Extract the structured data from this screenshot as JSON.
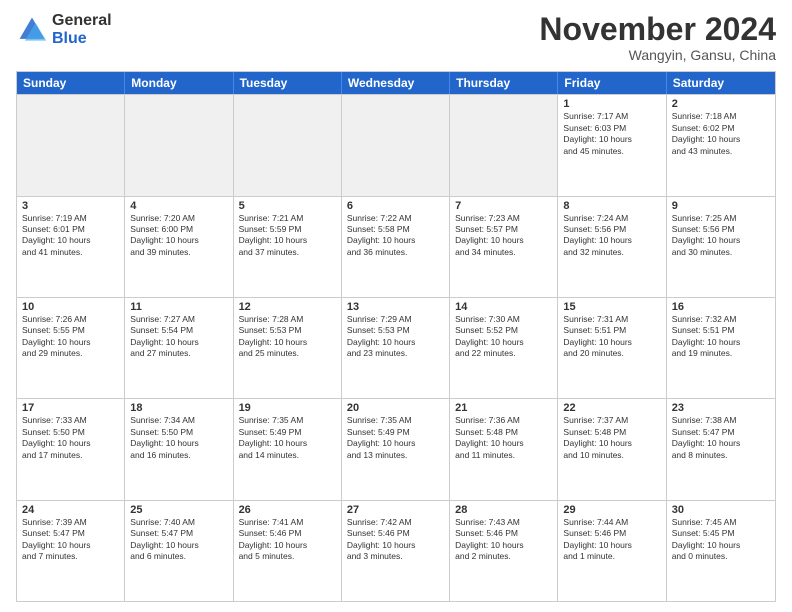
{
  "header": {
    "logo_general": "General",
    "logo_blue": "Blue",
    "month_title": "November 2024",
    "location": "Wangyin, Gansu, China"
  },
  "days_of_week": [
    "Sunday",
    "Monday",
    "Tuesday",
    "Wednesday",
    "Thursday",
    "Friday",
    "Saturday"
  ],
  "weeks": [
    [
      {
        "day": "",
        "info": ""
      },
      {
        "day": "",
        "info": ""
      },
      {
        "day": "",
        "info": ""
      },
      {
        "day": "",
        "info": ""
      },
      {
        "day": "",
        "info": ""
      },
      {
        "day": "1",
        "info": "Sunrise: 7:17 AM\nSunset: 6:03 PM\nDaylight: 10 hours\nand 45 minutes."
      },
      {
        "day": "2",
        "info": "Sunrise: 7:18 AM\nSunset: 6:02 PM\nDaylight: 10 hours\nand 43 minutes."
      }
    ],
    [
      {
        "day": "3",
        "info": "Sunrise: 7:19 AM\nSunset: 6:01 PM\nDaylight: 10 hours\nand 41 minutes."
      },
      {
        "day": "4",
        "info": "Sunrise: 7:20 AM\nSunset: 6:00 PM\nDaylight: 10 hours\nand 39 minutes."
      },
      {
        "day": "5",
        "info": "Sunrise: 7:21 AM\nSunset: 5:59 PM\nDaylight: 10 hours\nand 37 minutes."
      },
      {
        "day": "6",
        "info": "Sunrise: 7:22 AM\nSunset: 5:58 PM\nDaylight: 10 hours\nand 36 minutes."
      },
      {
        "day": "7",
        "info": "Sunrise: 7:23 AM\nSunset: 5:57 PM\nDaylight: 10 hours\nand 34 minutes."
      },
      {
        "day": "8",
        "info": "Sunrise: 7:24 AM\nSunset: 5:56 PM\nDaylight: 10 hours\nand 32 minutes."
      },
      {
        "day": "9",
        "info": "Sunrise: 7:25 AM\nSunset: 5:56 PM\nDaylight: 10 hours\nand 30 minutes."
      }
    ],
    [
      {
        "day": "10",
        "info": "Sunrise: 7:26 AM\nSunset: 5:55 PM\nDaylight: 10 hours\nand 29 minutes."
      },
      {
        "day": "11",
        "info": "Sunrise: 7:27 AM\nSunset: 5:54 PM\nDaylight: 10 hours\nand 27 minutes."
      },
      {
        "day": "12",
        "info": "Sunrise: 7:28 AM\nSunset: 5:53 PM\nDaylight: 10 hours\nand 25 minutes."
      },
      {
        "day": "13",
        "info": "Sunrise: 7:29 AM\nSunset: 5:53 PM\nDaylight: 10 hours\nand 23 minutes."
      },
      {
        "day": "14",
        "info": "Sunrise: 7:30 AM\nSunset: 5:52 PM\nDaylight: 10 hours\nand 22 minutes."
      },
      {
        "day": "15",
        "info": "Sunrise: 7:31 AM\nSunset: 5:51 PM\nDaylight: 10 hours\nand 20 minutes."
      },
      {
        "day": "16",
        "info": "Sunrise: 7:32 AM\nSunset: 5:51 PM\nDaylight: 10 hours\nand 19 minutes."
      }
    ],
    [
      {
        "day": "17",
        "info": "Sunrise: 7:33 AM\nSunset: 5:50 PM\nDaylight: 10 hours\nand 17 minutes."
      },
      {
        "day": "18",
        "info": "Sunrise: 7:34 AM\nSunset: 5:50 PM\nDaylight: 10 hours\nand 16 minutes."
      },
      {
        "day": "19",
        "info": "Sunrise: 7:35 AM\nSunset: 5:49 PM\nDaylight: 10 hours\nand 14 minutes."
      },
      {
        "day": "20",
        "info": "Sunrise: 7:35 AM\nSunset: 5:49 PM\nDaylight: 10 hours\nand 13 minutes."
      },
      {
        "day": "21",
        "info": "Sunrise: 7:36 AM\nSunset: 5:48 PM\nDaylight: 10 hours\nand 11 minutes."
      },
      {
        "day": "22",
        "info": "Sunrise: 7:37 AM\nSunset: 5:48 PM\nDaylight: 10 hours\nand 10 minutes."
      },
      {
        "day": "23",
        "info": "Sunrise: 7:38 AM\nSunset: 5:47 PM\nDaylight: 10 hours\nand 8 minutes."
      }
    ],
    [
      {
        "day": "24",
        "info": "Sunrise: 7:39 AM\nSunset: 5:47 PM\nDaylight: 10 hours\nand 7 minutes."
      },
      {
        "day": "25",
        "info": "Sunrise: 7:40 AM\nSunset: 5:47 PM\nDaylight: 10 hours\nand 6 minutes."
      },
      {
        "day": "26",
        "info": "Sunrise: 7:41 AM\nSunset: 5:46 PM\nDaylight: 10 hours\nand 5 minutes."
      },
      {
        "day": "27",
        "info": "Sunrise: 7:42 AM\nSunset: 5:46 PM\nDaylight: 10 hours\nand 3 minutes."
      },
      {
        "day": "28",
        "info": "Sunrise: 7:43 AM\nSunset: 5:46 PM\nDaylight: 10 hours\nand 2 minutes."
      },
      {
        "day": "29",
        "info": "Sunrise: 7:44 AM\nSunset: 5:46 PM\nDaylight: 10 hours\nand 1 minute."
      },
      {
        "day": "30",
        "info": "Sunrise: 7:45 AM\nSunset: 5:45 PM\nDaylight: 10 hours\nand 0 minutes."
      }
    ]
  ]
}
